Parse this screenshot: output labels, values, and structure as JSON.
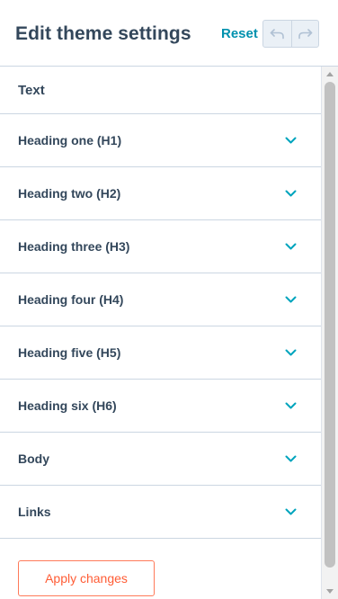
{
  "header": {
    "title": "Edit theme settings",
    "reset_label": "Reset",
    "undo_icon": "undo-icon",
    "redo_icon": "redo-icon"
  },
  "section": {
    "title": "Text"
  },
  "rows": [
    {
      "label": "Heading one (H1)",
      "icon": "chevron-down-icon"
    },
    {
      "label": "Heading two (H2)",
      "icon": "chevron-down-icon"
    },
    {
      "label": "Heading three (H3)",
      "icon": "chevron-down-icon"
    },
    {
      "label": "Heading four (H4)",
      "icon": "chevron-down-icon"
    },
    {
      "label": "Heading five (H5)",
      "icon": "chevron-down-icon"
    },
    {
      "label": "Heading six (H6)",
      "icon": "chevron-down-icon"
    },
    {
      "label": "Body",
      "icon": "chevron-down-icon"
    },
    {
      "label": "Links",
      "icon": "chevron-down-icon"
    }
  ],
  "footer": {
    "apply_label": "Apply changes"
  },
  "colors": {
    "text": "#33475b",
    "link_teal": "#0091ae",
    "chevron": "#00a4bd",
    "apply_orange": "#ff5c35",
    "border": "#cbd6e2"
  }
}
